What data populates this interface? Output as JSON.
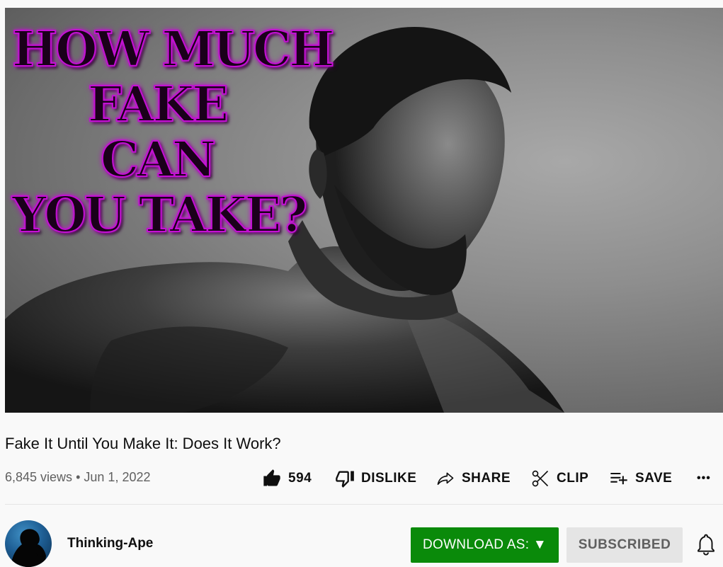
{
  "thumbnail": {
    "lines": [
      "HOW MUCH",
      "FAKE",
      "CAN",
      "YOU TAKE?"
    ]
  },
  "video": {
    "title": "Fake It Until You Make It: Does It Work?",
    "views": "6,845 views",
    "separator": "•",
    "date": "Jun 1, 2022"
  },
  "actions": {
    "like_count": "594",
    "dislike_label": "DISLIKE",
    "share_label": "SHARE",
    "clip_label": "CLIP",
    "save_label": "SAVE",
    "more_label": "•••"
  },
  "channel": {
    "name": "Thinking-Ape"
  },
  "buttons": {
    "download_label": "DOWNLOAD AS: ▼",
    "subscribed_label": "SUBSCRIBED"
  },
  "colors": {
    "download_bg": "#0a8a0a",
    "subscribed_bg": "#e5e5e5",
    "thumbnail_text_glow": "#c410d4"
  },
  "icons": {
    "like": "thumbs-up-filled",
    "dislike": "thumbs-down-outline",
    "share": "share-arrow",
    "clip": "scissors",
    "save": "playlist-add",
    "more": "ellipsis",
    "bell": "notification-bell"
  }
}
